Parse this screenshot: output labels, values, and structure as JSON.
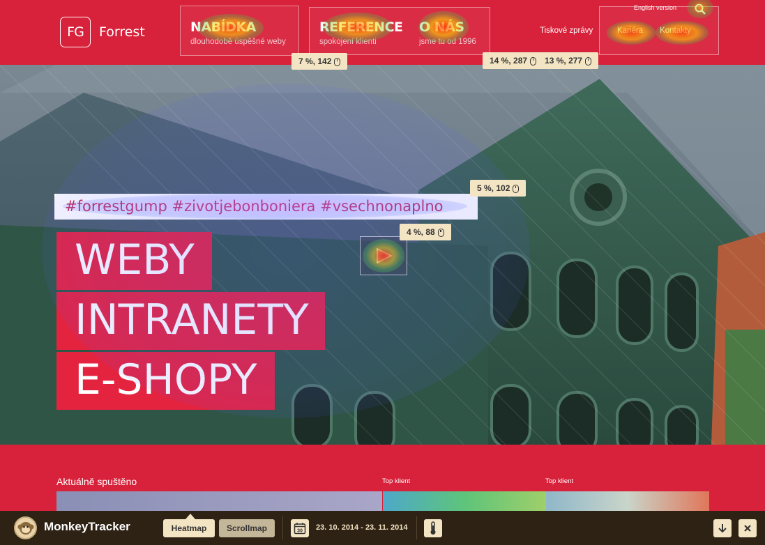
{
  "header": {
    "logo_mark": "FG",
    "logo_name": "Forrest",
    "nav": [
      {
        "title": "NABÍDKA",
        "subtitle": "dlouhodobě úspěšné weby"
      },
      {
        "title": "REFERENCE",
        "subtitle": "spokojení klienti"
      },
      {
        "title": "O NÁS",
        "subtitle": "jsme tu od 1996"
      }
    ],
    "press_link": "Tiskové zprávy",
    "english_link": "English version",
    "search_icon": "search-icon",
    "top_links": [
      "Kariéra",
      "Kontakty"
    ]
  },
  "hero": {
    "hashtags": "#forrestgump #zivotjebonboniera #vsechnonaplno",
    "claims": [
      "WEBY",
      "INTRANETY",
      "E-SHOPY"
    ],
    "play_icon": "play-icon"
  },
  "stats": {
    "nabidka": "7 %, 142",
    "reference": "14 %, 287",
    "o_nas": "13 %, 277",
    "hashtags": "5 %, 102",
    "video": "4 %, 88"
  },
  "lower": {
    "section_title": "Aktuálně spuštěno",
    "top_client_1": "Top klient",
    "top_client_2": "Top klient"
  },
  "tracker": {
    "name": "MonkeyTracker",
    "heatmap_label": "Heatmap",
    "scrollmap_label": "Scrollmap",
    "calendar_icon": "calendar-icon",
    "calendar_day": "30",
    "date_range": "23. 10. 2014 - 23. 11. 2014",
    "thermometer_icon": "thermometer-icon",
    "collapse_icon": "chevron-down-icon",
    "close_icon": "close-icon",
    "active_mode": "Heatmap"
  },
  "colors": {
    "brand_red": "#d8213a",
    "tracker_bg": "#2e2214",
    "bubble": "#f3e4c4"
  }
}
